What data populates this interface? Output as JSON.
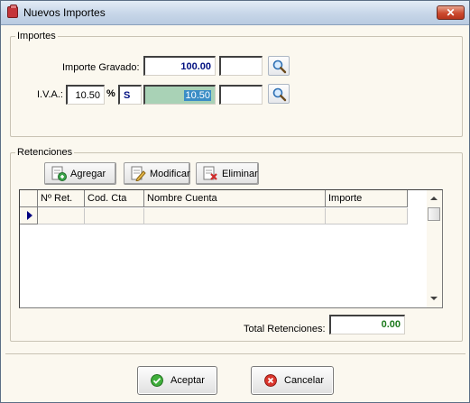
{
  "window": {
    "title": "Nuevos Importes",
    "close_label": "✕"
  },
  "importes": {
    "group_label": "Importes",
    "importe_gravado_label": "Importe Gravado:",
    "importe_gravado_value": "100.00",
    "importe_gravado_extra": "",
    "iva_label": "I.V.A.:",
    "iva_rate": "10.50",
    "percent_sign": "%",
    "iva_flag": "S",
    "iva_amount": "10.50",
    "iva_extra": ""
  },
  "retenciones": {
    "group_label": "Retenciones",
    "buttons": {
      "add": "Agregar",
      "modify": "Modificar",
      "delete": "Eliminar"
    },
    "columns": [
      "Nº Ret.",
      "Cod. Cta",
      "Nombre Cuenta",
      "Importe"
    ],
    "total_label": "Total Retenciones:",
    "total_value": "0.00"
  },
  "footer": {
    "accept": "Aceptar",
    "cancel": "Cancelar"
  },
  "colors": {
    "titlebar": "#c7d6e8",
    "background": "#fbf8ef",
    "value_blue": "#000f80",
    "total_green": "#1c7a1c",
    "selection": "#3a8dc6"
  },
  "icons": [
    "document-icon",
    "close-icon",
    "search-icon",
    "add-icon",
    "edit-icon",
    "delete-icon",
    "accept-icon",
    "cancel-icon",
    "row-indicator-icon"
  ]
}
